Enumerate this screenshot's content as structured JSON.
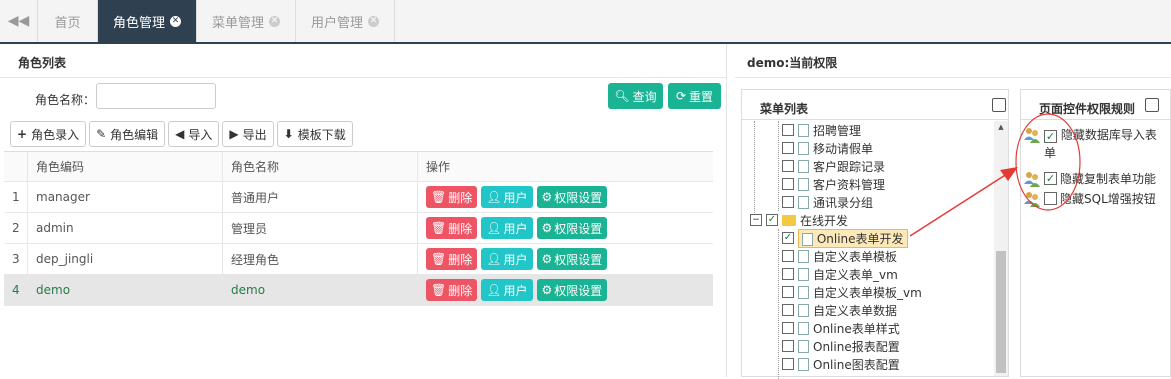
{
  "tabs": {
    "home": "首页",
    "role": "角色管理",
    "menu": "菜单管理",
    "user": "用户管理"
  },
  "left": {
    "title": "角色列表",
    "search_label": "角色名称：",
    "search_value": "",
    "query_label": "查询",
    "reset_label": "重置",
    "toolbar": {
      "add": "角色录入",
      "edit": "角色编辑",
      "import": "导入",
      "export": "导出",
      "template": "模板下载"
    },
    "columns": [
      "角色编码",
      "角色名称",
      "操作"
    ],
    "rows": [
      {
        "idx": "1",
        "code": "manager",
        "name": "普通用户"
      },
      {
        "idx": "2",
        "code": "admin",
        "name": "管理员"
      },
      {
        "idx": "3",
        "code": "dep_jingli",
        "name": "经理角色"
      },
      {
        "idx": "4",
        "code": "demo",
        "name": "demo"
      }
    ],
    "actions": {
      "delete": "删除",
      "user": "用户",
      "perm": "权限设置"
    }
  },
  "right": {
    "title": "demo:当前权限",
    "menu_title": "菜单列表",
    "ctrl_title": "页面控件权限规则",
    "tree": [
      "招聘管理",
      "移动请假单",
      "客户跟踪记录",
      "客户资料管理",
      "通讯录分组",
      "在线开发",
      "Online表单开发",
      "自定义表单模板",
      "自定义表单_vm",
      "自定义表单模板_vm",
      "自定义表单数据",
      "Online表单样式",
      "Online报表配置",
      "Online图表配置"
    ],
    "rules": [
      {
        "label": "隐藏数据库导入表单",
        "checked": true
      },
      {
        "label": "隐藏复制表单功能",
        "checked": true
      },
      {
        "label": "隐藏SQL增强按钮",
        "checked": false
      }
    ]
  },
  "colors": {
    "accent": "#1ab394",
    "danger": "#ed5565",
    "info": "#23c6c8",
    "tab_active": "#2f4050",
    "annotation": "#e53935"
  }
}
